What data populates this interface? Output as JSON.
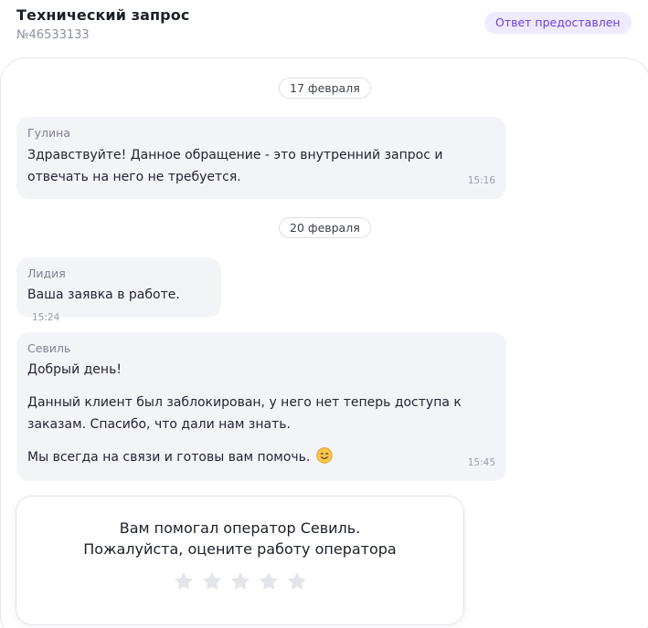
{
  "header": {
    "title": "Технический запрос",
    "number": "№46533133",
    "status": "Ответ предоставлен"
  },
  "dates": [
    "17 февраля",
    "20 февраля"
  ],
  "messages": [
    {
      "author": "Гулина",
      "lines": [
        "Здравствуйте! Данное обращение - это внутренний запрос и",
        "отвечать на него не требуется."
      ],
      "time": "15:16"
    },
    {
      "author": "Лидия",
      "lines": [
        "Ваша заявка в работе."
      ],
      "time": "15:24"
    },
    {
      "author": "Севиль",
      "lines": [
        "Добрый день!",
        "Данный клиент был заблокирован, у него нет теперь доступа к",
        "заказам. Спасибо, что дали нам знать.",
        "Мы всегда на связи и готовы вам помочь."
      ],
      "emoji": "smiling-face-icon",
      "time": "15:45"
    }
  ],
  "rating": {
    "line1": "Вам помогал оператор Севиль.",
    "line2": "Пожалуйста, оцените работу оператора",
    "stars_count": 5,
    "selected": 0,
    "star_icon": "star-icon",
    "star_color": "#e3e5ea"
  },
  "colors": {
    "accent": "#6b3fe0",
    "badge_bg": "#efeafd",
    "bubble_bg": "#f3f4f8"
  }
}
